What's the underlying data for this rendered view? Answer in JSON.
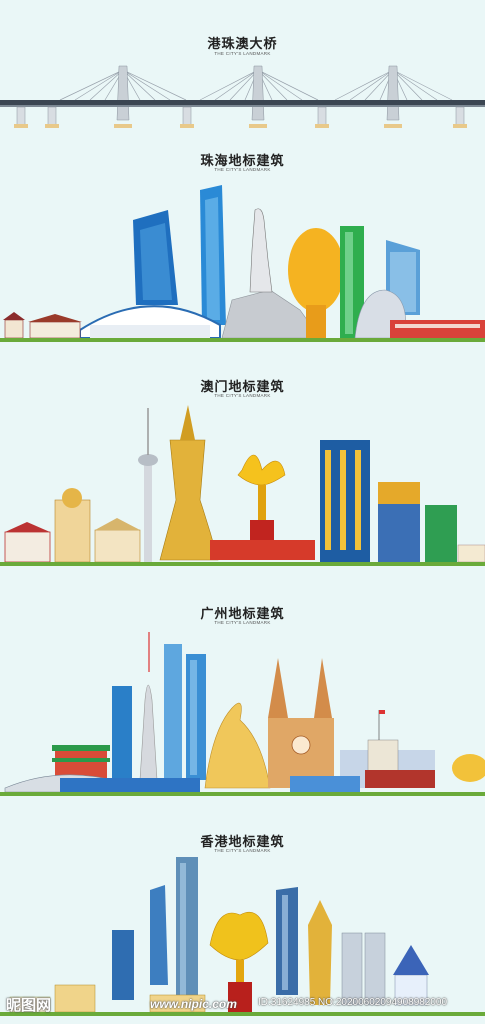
{
  "sections": [
    {
      "title": "港珠澳大桥",
      "subtitle": "THE CITY'S LANDMARK"
    },
    {
      "title": "珠海地标建筑",
      "subtitle": "THE CITY'S LANDMARK"
    },
    {
      "title": "澳门地标建筑",
      "subtitle": "THE CITY'S LANDMARK"
    },
    {
      "title": "广州地标建筑",
      "subtitle": "THE CITY'S LANDMARK"
    },
    {
      "title": "香港地标建筑",
      "subtitle": "THE CITY'S LANDMARK"
    }
  ],
  "watermark": {
    "logo": "昵图网",
    "site": "www.nipic.com",
    "id": "ID:31624985 NO:20200602094908982000"
  }
}
